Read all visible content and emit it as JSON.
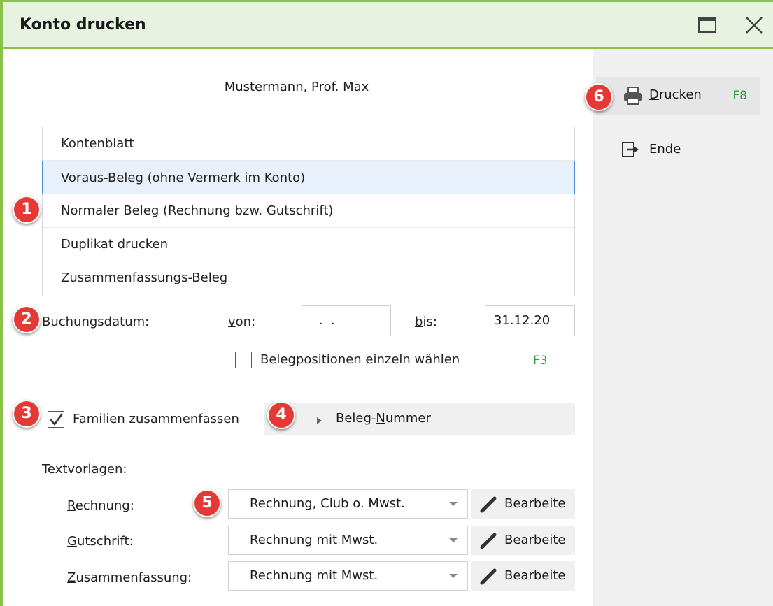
{
  "window": {
    "title": "Konto drucken"
  },
  "customer_name": "Mustermann, Prof. Max",
  "print_options": [
    "Kontenblatt",
    "Voraus-Beleg (ohne Vermerk im Konto)",
    "Normaler Beleg (Rechnung bzw. Gutschrift)",
    "Duplikat drucken",
    "Zusammenfassungs-Beleg"
  ],
  "selected_option": "Voraus-Beleg (ohne Vermerk im Konto)",
  "booking_date": {
    "label": "Buchungsdatum:",
    "from_label_ul": "v",
    "from_label_rest": "on:",
    "from_value": " .  .",
    "to_label_ul": "b",
    "to_label_rest": "is:",
    "to_value": "31.12.20"
  },
  "select_positions": {
    "label": "Belegpositionen einzeln wählen",
    "key": "F3",
    "checked": false
  },
  "family": {
    "label_pre": "Familien ",
    "label_ul": "z",
    "label_post": "usammenfassen",
    "checked": true
  },
  "beleg_nummer": {
    "pre": "Beleg-",
    "ul": "N",
    "post": "ummer"
  },
  "templates": {
    "heading": "Textvorlagen:",
    "rows": [
      {
        "label_ul": "R",
        "label_rest": "echnung:",
        "value": "Rechnung, Club o. Mwst.",
        "edit": "Bearbeite"
      },
      {
        "label_ul": "G",
        "label_rest": "utschrift:",
        "value": "Rechnung mit Mwst.",
        "edit": "Bearbeite"
      },
      {
        "label_ul": "Z",
        "label_rest": "usammenfassung:",
        "value": "Rechnung mit Mwst.",
        "edit": "Bearbeite"
      }
    ]
  },
  "side": {
    "print": {
      "ul": "D",
      "rest": "rucken",
      "key": "F8"
    },
    "exit": {
      "ul": "E",
      "rest": "nde"
    }
  },
  "badges": [
    "1",
    "2",
    "3",
    "4",
    "5",
    "6"
  ],
  "colors": {
    "title_bg": "#e7f2e1",
    "accent_green": "#8bc34a",
    "key_green": "#2e9c3d",
    "badge_red": "#e53935",
    "selection": "#4a8fe0"
  }
}
